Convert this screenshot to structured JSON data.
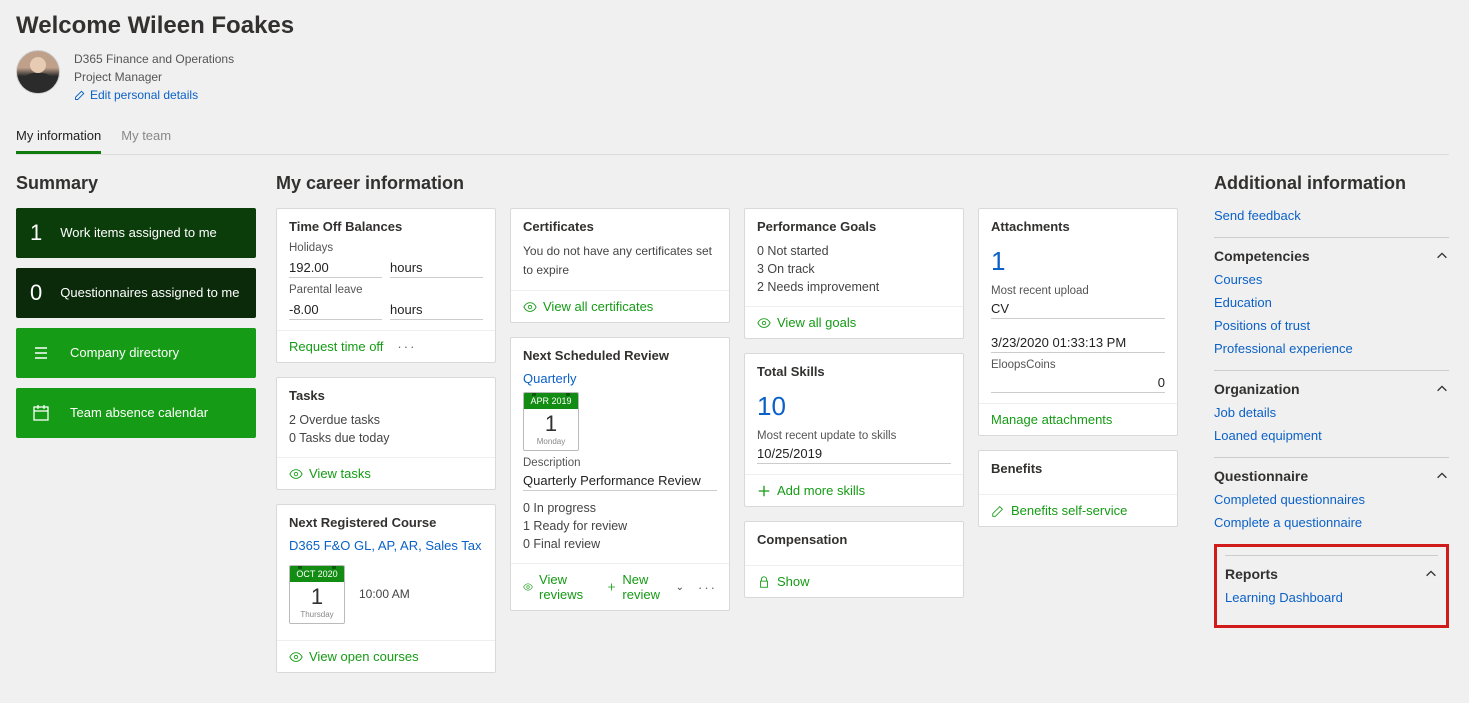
{
  "header": {
    "welcome": "Welcome Wileen Foakes",
    "dept": "D365 Finance and Operations",
    "role": "Project Manager",
    "edit_link": "Edit personal details"
  },
  "tabs": {
    "my_info": "My information",
    "my_team": "My team"
  },
  "summary": {
    "title": "Summary",
    "tiles": {
      "work_items": {
        "count": "1",
        "label": "Work items assigned to me"
      },
      "questionnaires": {
        "count": "0",
        "label": "Questionnaires assigned to me"
      },
      "company_dir": "Company directory",
      "team_absence": "Team absence calendar"
    }
  },
  "career": {
    "title": "My career information",
    "timeoff": {
      "card_title": "Time Off Balances",
      "holidays_label": "Holidays",
      "holidays_value": "192.00",
      "holidays_unit": "hours",
      "parental_label": "Parental leave",
      "parental_value": "-8.00",
      "parental_unit": "hours",
      "action": "Request time off"
    },
    "tasks": {
      "card_title": "Tasks",
      "overdue": "2 Overdue tasks",
      "today": "0 Tasks due today",
      "action": "View tasks"
    },
    "next_course": {
      "card_title": "Next Registered Course",
      "link": "D365 F&O GL, AP, AR, Sales Tax",
      "cal": {
        "month": "OCT 2020",
        "day": "1",
        "dow": "Thursday"
      },
      "time": "10:00 AM",
      "action": "View open courses"
    },
    "certs": {
      "card_title": "Certificates",
      "text": "You do not have any certificates set to expire",
      "action": "View all certificates"
    },
    "review": {
      "card_title": "Next Scheduled Review",
      "link": "Quarterly",
      "cal": {
        "month": "APR 2019",
        "day": "1",
        "dow": "Monday"
      },
      "desc_label": "Description",
      "desc_value": "Quarterly Performance Review",
      "in_progress": "0 In progress",
      "ready": "1 Ready for review",
      "final": "0 Final review",
      "view": "View reviews",
      "new": "New review"
    },
    "goals": {
      "card_title": "Performance Goals",
      "not_started": "0 Not started",
      "on_track": "3 On track",
      "needs": "2 Needs improvement",
      "action": "View all goals"
    },
    "skills": {
      "card_title": "Total Skills",
      "count": "10",
      "recent_label": "Most recent update to skills",
      "recent_value": "10/25/2019",
      "action": "Add more skills"
    },
    "compensation": {
      "card_title": "Compensation",
      "action": "Show"
    },
    "attachments": {
      "card_title": "Attachments",
      "count": "1",
      "recent_label": "Most recent upload",
      "recent_value": "CV",
      "date": "3/23/2020 01:33:13 PM",
      "coins_label": "EloopsCoins",
      "coins_value": "0",
      "action": "Manage attachments"
    },
    "benefits": {
      "card_title": "Benefits",
      "action": "Benefits self-service"
    }
  },
  "right": {
    "title": "Additional information",
    "send_feedback": "Send feedback",
    "competencies": {
      "title": "Competencies",
      "courses": "Courses",
      "education": "Education",
      "trust": "Positions of trust",
      "prof": "Professional experience"
    },
    "org": {
      "title": "Organization",
      "job": "Job details",
      "loaned": "Loaned equipment"
    },
    "questionnaire": {
      "title": "Questionnaire",
      "completed": "Completed questionnaires",
      "complete_a": "Complete a questionnaire"
    },
    "reports": {
      "title": "Reports",
      "learning": "Learning Dashboard"
    }
  }
}
